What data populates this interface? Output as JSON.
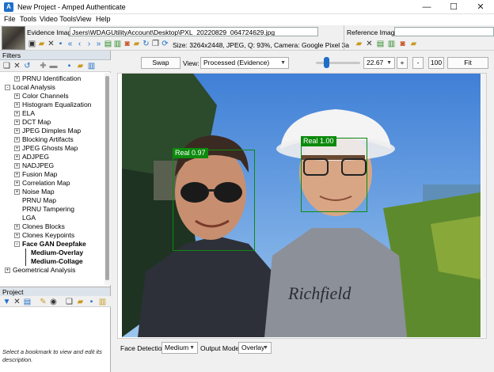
{
  "window": {
    "title": "New Project - Amped Authenticate",
    "icon": "app-logo-icon",
    "controls": {
      "minimize": "—",
      "maximize": "☐",
      "close": "✕"
    }
  },
  "menu": [
    "File",
    "Tools",
    "Video Tools",
    "View",
    "Help"
  ],
  "evidence": {
    "label": "Evidence Image:",
    "path": "Jsers\\WDAGUtilityAccount\\Desktop\\PXL_20220829_064724629.jpg",
    "info": "Size: 3264x2448, JPEG, Q: 93%, Camera: Google Pixel 3a"
  },
  "reference": {
    "label": "Reference Image:",
    "path": ""
  },
  "filters": {
    "header": "Filters",
    "items": [
      {
        "label": "PRNU Identification",
        "level": 1,
        "expander": "+",
        "bold": false
      },
      {
        "label": "Local Analysis",
        "level": 0,
        "expander": "-",
        "bold": false
      },
      {
        "label": "Color Channels",
        "level": 1,
        "expander": "+",
        "bold": false
      },
      {
        "label": "Histogram Equalization",
        "level": 1,
        "expander": "+",
        "bold": false
      },
      {
        "label": "ELA",
        "level": 1,
        "expander": "+",
        "bold": false
      },
      {
        "label": "DCT Map",
        "level": 1,
        "expander": "+",
        "bold": false
      },
      {
        "label": "JPEG Dimples Map",
        "level": 1,
        "expander": "+",
        "bold": false
      },
      {
        "label": "Blocking Artifacts",
        "level": 1,
        "expander": "+",
        "bold": false
      },
      {
        "label": "JPEG Ghosts Map",
        "level": 1,
        "expander": "+",
        "bold": false
      },
      {
        "label": "ADJPEG",
        "level": 1,
        "expander": "+",
        "bold": false
      },
      {
        "label": "NADJPEG",
        "level": 1,
        "expander": "+",
        "bold": false
      },
      {
        "label": "Fusion Map",
        "level": 1,
        "expander": "+",
        "bold": false
      },
      {
        "label": "Correlation Map",
        "level": 1,
        "expander": "+",
        "bold": false
      },
      {
        "label": "Noise Map",
        "level": 1,
        "expander": "+",
        "bold": false
      },
      {
        "label": "PRNU Map",
        "level": 1,
        "expander": "",
        "bold": false
      },
      {
        "label": "PRNU Tampering",
        "level": 1,
        "expander": "",
        "bold": false
      },
      {
        "label": "LGA",
        "level": 1,
        "expander": "",
        "bold": false
      },
      {
        "label": "Clones Blocks",
        "level": 1,
        "expander": "+",
        "bold": false
      },
      {
        "label": "Clones Keypoints",
        "level": 1,
        "expander": "+",
        "bold": false
      },
      {
        "label": "Face GAN Deepfake",
        "level": 1,
        "expander": "-",
        "bold": true
      },
      {
        "label": "Medium-Overlay",
        "level": 2,
        "expander": "",
        "bold": true
      },
      {
        "label": "Medium-Collage",
        "level": 2,
        "expander": "",
        "bold": true
      },
      {
        "label": "Geometrical Analysis",
        "level": 0,
        "expander": "+",
        "bold": false
      }
    ]
  },
  "project": {
    "header": "Project",
    "hint": "Select a bookmark to view and edit its description."
  },
  "view": {
    "swap_label": "Swap",
    "view_label": "View:",
    "view_value": "Processed (Evidence)",
    "slider_level_percent": 18,
    "zoom_value": "22.67",
    "zoom_in": "+",
    "zoom_out": "-",
    "zoom_100": "100",
    "fit": "Fit"
  },
  "detections": [
    {
      "label": "Real 0.97"
    },
    {
      "label": "Real 1.00"
    }
  ],
  "bottom": {
    "face_detection_label": "Face Detection:",
    "face_detection_value": "Medium",
    "output_mode_label": "Output Mode:",
    "output_mode_value": "Overlay"
  },
  "colors": {
    "detection": "#0c8a0c",
    "accent": "#1e6fc9"
  }
}
